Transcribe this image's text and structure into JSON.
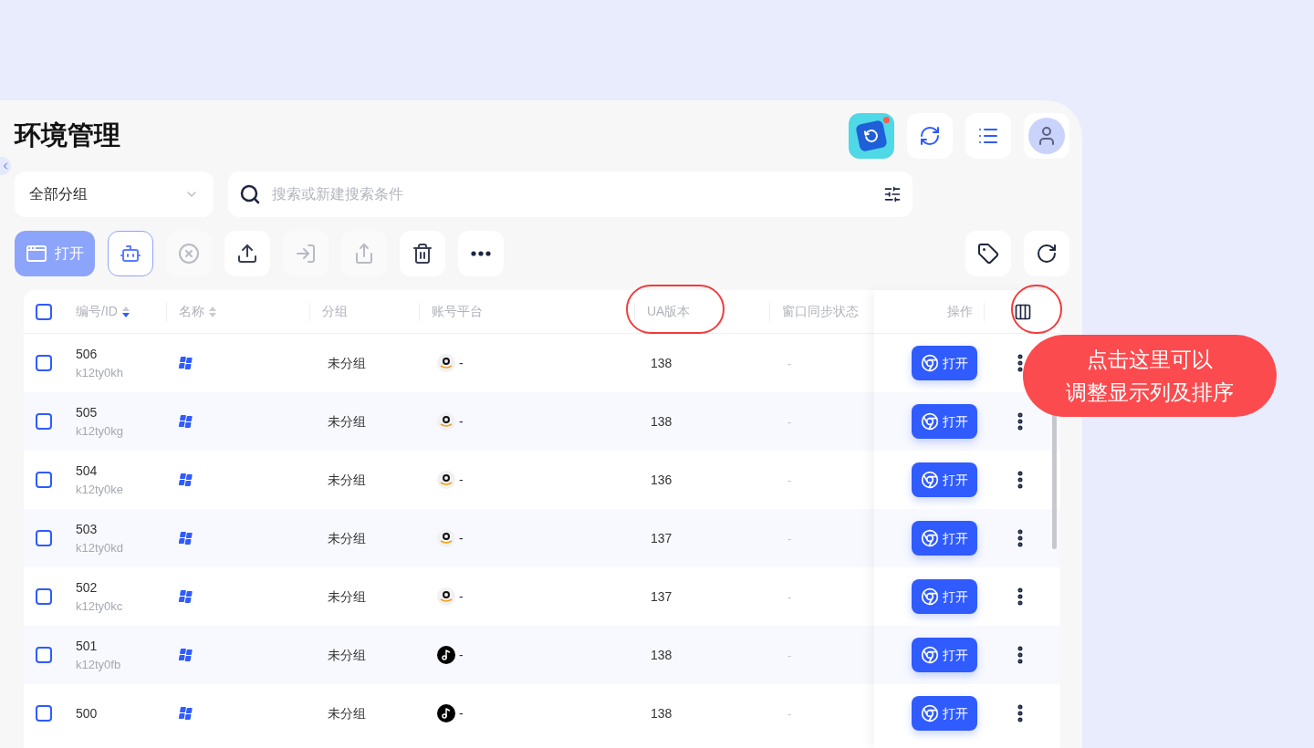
{
  "page": {
    "title": "环境管理"
  },
  "header_actions": [
    {
      "kind": "logo",
      "badge": true
    },
    {
      "kind": "sync"
    },
    {
      "kind": "list"
    },
    {
      "kind": "avatar"
    }
  ],
  "group_select": {
    "value": "全部分组"
  },
  "search": {
    "placeholder": "搜索或新建搜索条件"
  },
  "toolbar": [
    {
      "kind": "open",
      "label": "打开",
      "disabled": true
    },
    {
      "kind": "robot",
      "disabled": false
    },
    {
      "kind": "stop",
      "disabled": true
    },
    {
      "kind": "upload",
      "disabled": false
    },
    {
      "kind": "import",
      "disabled": true
    },
    {
      "kind": "share",
      "disabled": true
    },
    {
      "kind": "delete",
      "disabled": false
    },
    {
      "kind": "more",
      "disabled": false
    }
  ],
  "toolbar_right": [
    {
      "kind": "tag"
    },
    {
      "kind": "refresh"
    }
  ],
  "table": {
    "select_all": {
      "checked": false
    },
    "columns": [
      {
        "label": "编号/ID",
        "sortable": true,
        "sorted": true
      },
      {
        "label": "名称",
        "sortable": true,
        "sorted": false
      },
      {
        "label": "分组"
      },
      {
        "label": "账号平台"
      },
      {
        "label": "UA版本"
      },
      {
        "label": "窗口同步状态"
      },
      {
        "label": "操作"
      }
    ],
    "rows": [
      {
        "checked": false,
        "id": "506",
        "serial": "k12ty0kh",
        "group": "未分组",
        "platform": {
          "kind": "amazon",
          "text": "-"
        },
        "ua": "138",
        "sync": "-",
        "action": "打开"
      },
      {
        "checked": false,
        "id": "505",
        "serial": "k12ty0kg",
        "group": "未分组",
        "platform": {
          "kind": "amazon",
          "text": "-"
        },
        "ua": "138",
        "sync": "-",
        "action": "打开"
      },
      {
        "checked": false,
        "id": "504",
        "serial": "k12ty0ke",
        "group": "未分组",
        "platform": {
          "kind": "amazon",
          "text": "-"
        },
        "ua": "136",
        "sync": "-",
        "action": "打开"
      },
      {
        "checked": false,
        "id": "503",
        "serial": "k12ty0kd",
        "group": "未分组",
        "platform": {
          "kind": "amazon",
          "text": "-"
        },
        "ua": "137",
        "sync": "-",
        "action": "打开"
      },
      {
        "checked": false,
        "id": "502",
        "serial": "k12ty0kc",
        "group": "未分组",
        "platform": {
          "kind": "amazon",
          "text": "-"
        },
        "ua": "137",
        "sync": "-",
        "action": "打开"
      },
      {
        "checked": false,
        "id": "501",
        "serial": "k12ty0fb",
        "group": "未分组",
        "platform": {
          "kind": "tiktok",
          "text": "-"
        },
        "ua": "138",
        "sync": "-",
        "action": "打开"
      },
      {
        "checked": false,
        "id": "500",
        "group": "未分组",
        "platform": {
          "kind": "tiktok",
          "text": "-"
        },
        "ua": "138",
        "sync": "-",
        "action": "打开"
      }
    ]
  },
  "annotation": {
    "lines": [
      "点击这里可以",
      "调整显示列及排序"
    ]
  }
}
